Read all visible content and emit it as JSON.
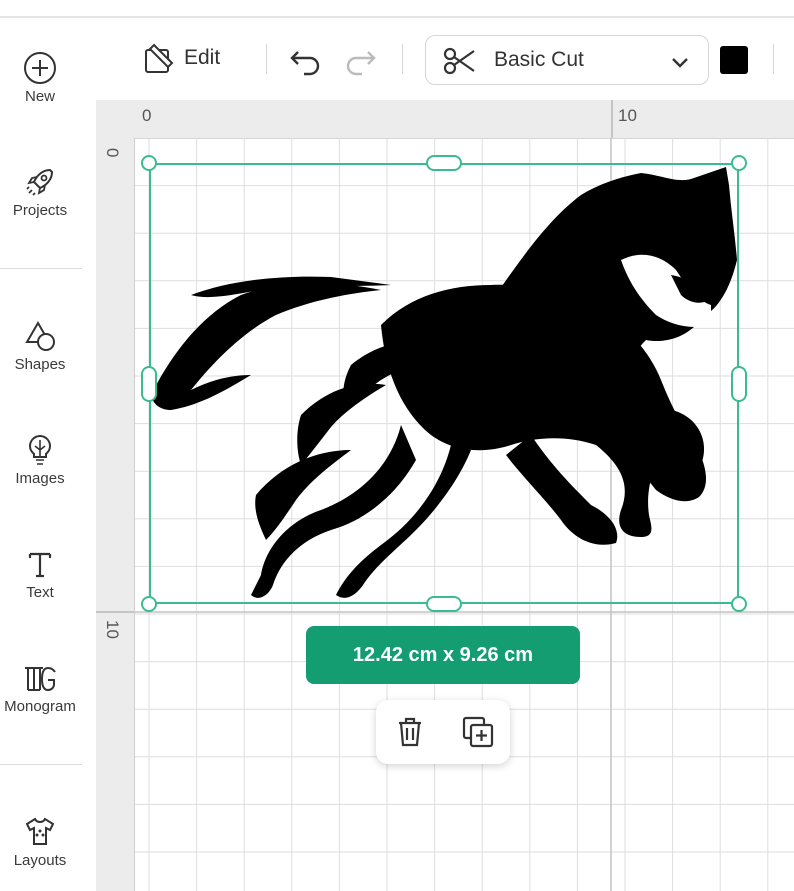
{
  "sidebar": {
    "items": [
      {
        "label": "New",
        "icon": "plus-circle-icon"
      },
      {
        "label": "Projects",
        "icon": "rocket-icon"
      },
      {
        "label": "Shapes",
        "icon": "shapes-icon"
      },
      {
        "label": "Images",
        "icon": "lightbulb-icon"
      },
      {
        "label": "Text",
        "icon": "text-t-icon"
      },
      {
        "label": "Monogram",
        "icon": "monogram-icon"
      },
      {
        "label": "Layouts",
        "icon": "shirt-icon"
      }
    ]
  },
  "toolbar": {
    "edit_label": "Edit",
    "operation_label": "Basic Cut",
    "color": "#000000"
  },
  "rulers": {
    "top_labels": [
      "0",
      "10"
    ],
    "left_labels": [
      "0",
      "10"
    ]
  },
  "selection": {
    "dimensions": "12.42  cm x 9.26  cm",
    "accent_color": "#3bbc8e",
    "badge_color": "#159d72"
  },
  "object_actions": {
    "delete_icon": "trash-icon",
    "duplicate_icon": "duplicate-icon"
  }
}
